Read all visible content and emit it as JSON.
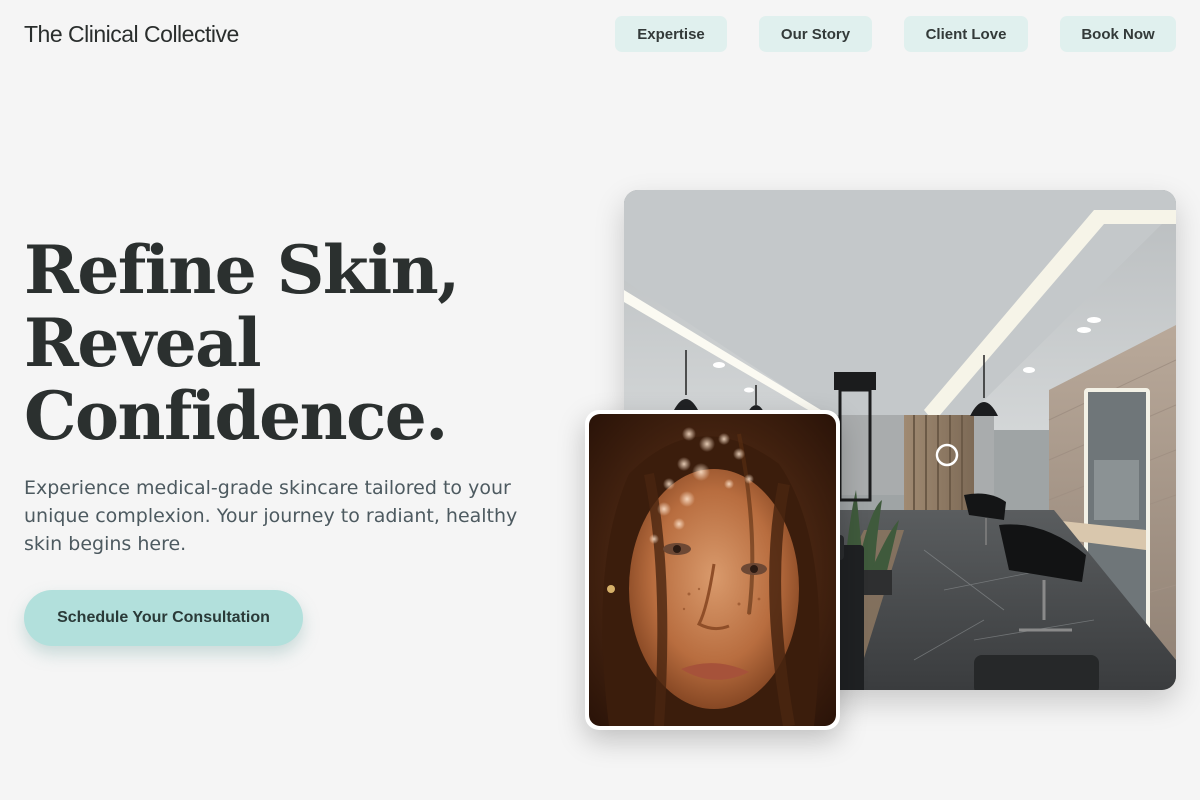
{
  "header": {
    "brand": "The Clinical Collective",
    "nav": [
      {
        "label": "Expertise"
      },
      {
        "label": "Our Story"
      },
      {
        "label": "Client Love"
      },
      {
        "label": "Book Now"
      }
    ]
  },
  "hero": {
    "title_lines": [
      "Refine Skin,",
      "Reveal",
      "Confidence."
    ],
    "subtitle": "Experience medical-grade skincare tailored to your unique complexion. Your journey to radiant, healthy skin begins here.",
    "cta_label": "Schedule Your Consultation"
  },
  "colors": {
    "background": "#f5f5f5",
    "nav_button": "#e0f0ee",
    "cta": "#b2e0dc",
    "heading": "#2b302f",
    "body_text": "#4d5a60"
  }
}
